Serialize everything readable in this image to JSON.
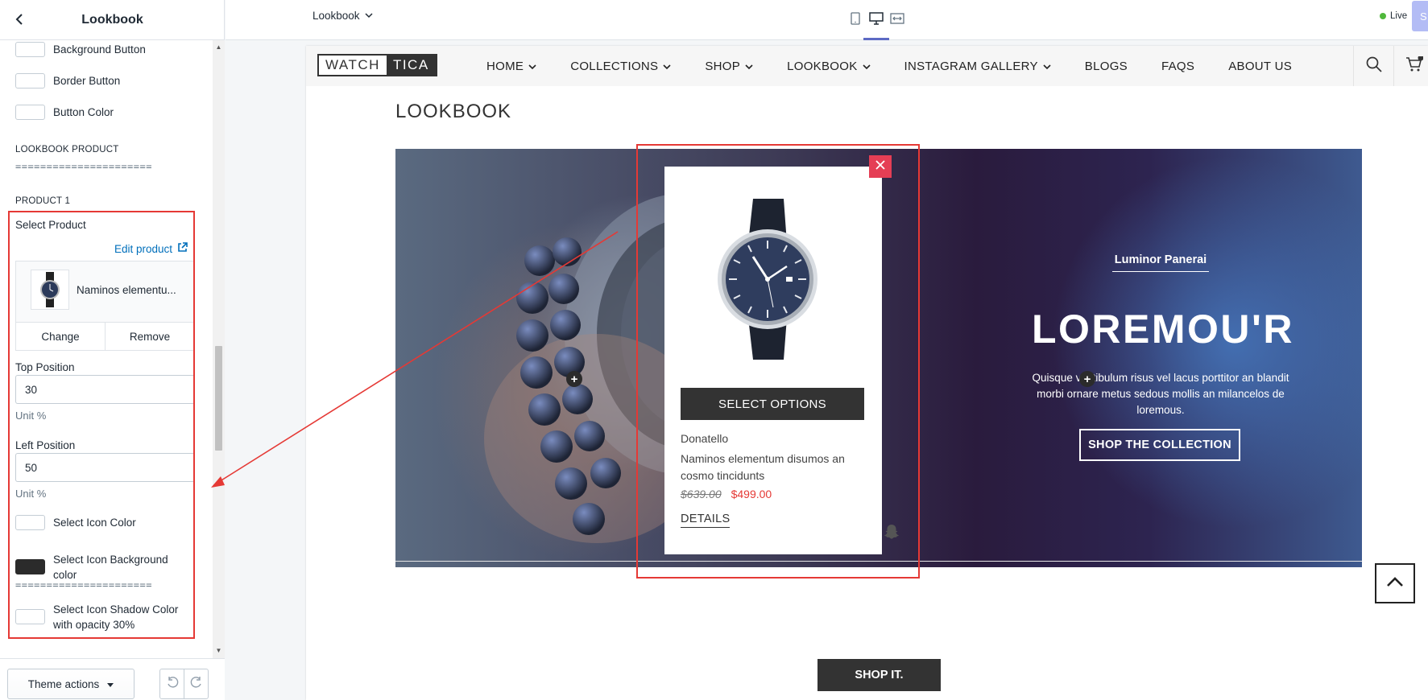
{
  "sidebar": {
    "title": "Lookbook",
    "colors": [
      {
        "label": "Background Button"
      },
      {
        "label": "Border Button"
      },
      {
        "label": "Button Color"
      }
    ],
    "section_heading": "LOOKBOOK PRODUCT",
    "divider": "======================",
    "product": {
      "heading": "PRODUCT 1",
      "select_label": "Select Product",
      "edit_link": "Edit product",
      "product_name": "Naminos elementu...",
      "change": "Change",
      "remove": "Remove",
      "top_label": "Top Position",
      "top_value": "30",
      "top_unit": "Unit %",
      "left_label": "Left Position",
      "left_value": "50",
      "left_unit": "Unit %",
      "icon_color": "Select Icon Color",
      "icon_bg_color": "Select Icon Background color",
      "icon_shadow": "Select Icon Shadow Color with opacity 30%"
    },
    "divider2": "======================",
    "theme_actions": "Theme actions"
  },
  "topbar": {
    "page": "Lookbook",
    "live": "Live",
    "save": "S"
  },
  "store": {
    "logo_a": "WATCH",
    "logo_b": "TICA",
    "menu": [
      {
        "label": "HOME",
        "dropdown": true
      },
      {
        "label": "COLLECTIONS",
        "dropdown": true
      },
      {
        "label": "SHOP",
        "dropdown": true
      },
      {
        "label": "LOOKBOOK",
        "dropdown": true
      },
      {
        "label": "INSTAGRAM GALLERY",
        "dropdown": true
      },
      {
        "label": "BLOGS",
        "dropdown": false
      },
      {
        "label": "FAQS",
        "dropdown": false
      },
      {
        "label": "ABOUT US",
        "dropdown": false
      }
    ],
    "page_title": "LOOKBOOK",
    "hero": {
      "subtitle": "Luminor Panerai",
      "title": "LOREMOU'R",
      "text": "Quisque vestibulum risus vel lacus porttitor an blandit morbi ornare metus sedous mollis an milancelos de loremous.",
      "button": "SHOP THE COLLECTION"
    },
    "popup": {
      "select_options": "SELECT OPTIONS",
      "vendor": "Donatello",
      "title": "Naminos elementum disumos an cosmo tincidunts",
      "compare_price": "$639.00",
      "price": "$499.00",
      "details": "DETAILS"
    },
    "social": [
      "facebook-icon",
      "twitter-icon",
      "google-plus-icon",
      "instagram-icon",
      "snapchat-icon"
    ],
    "shop_it": "SHOP IT."
  },
  "colors": {
    "accent": "#5c6ac4",
    "annotation": "#e53935",
    "close": "#e53e55",
    "sale_price": "#e53935"
  }
}
